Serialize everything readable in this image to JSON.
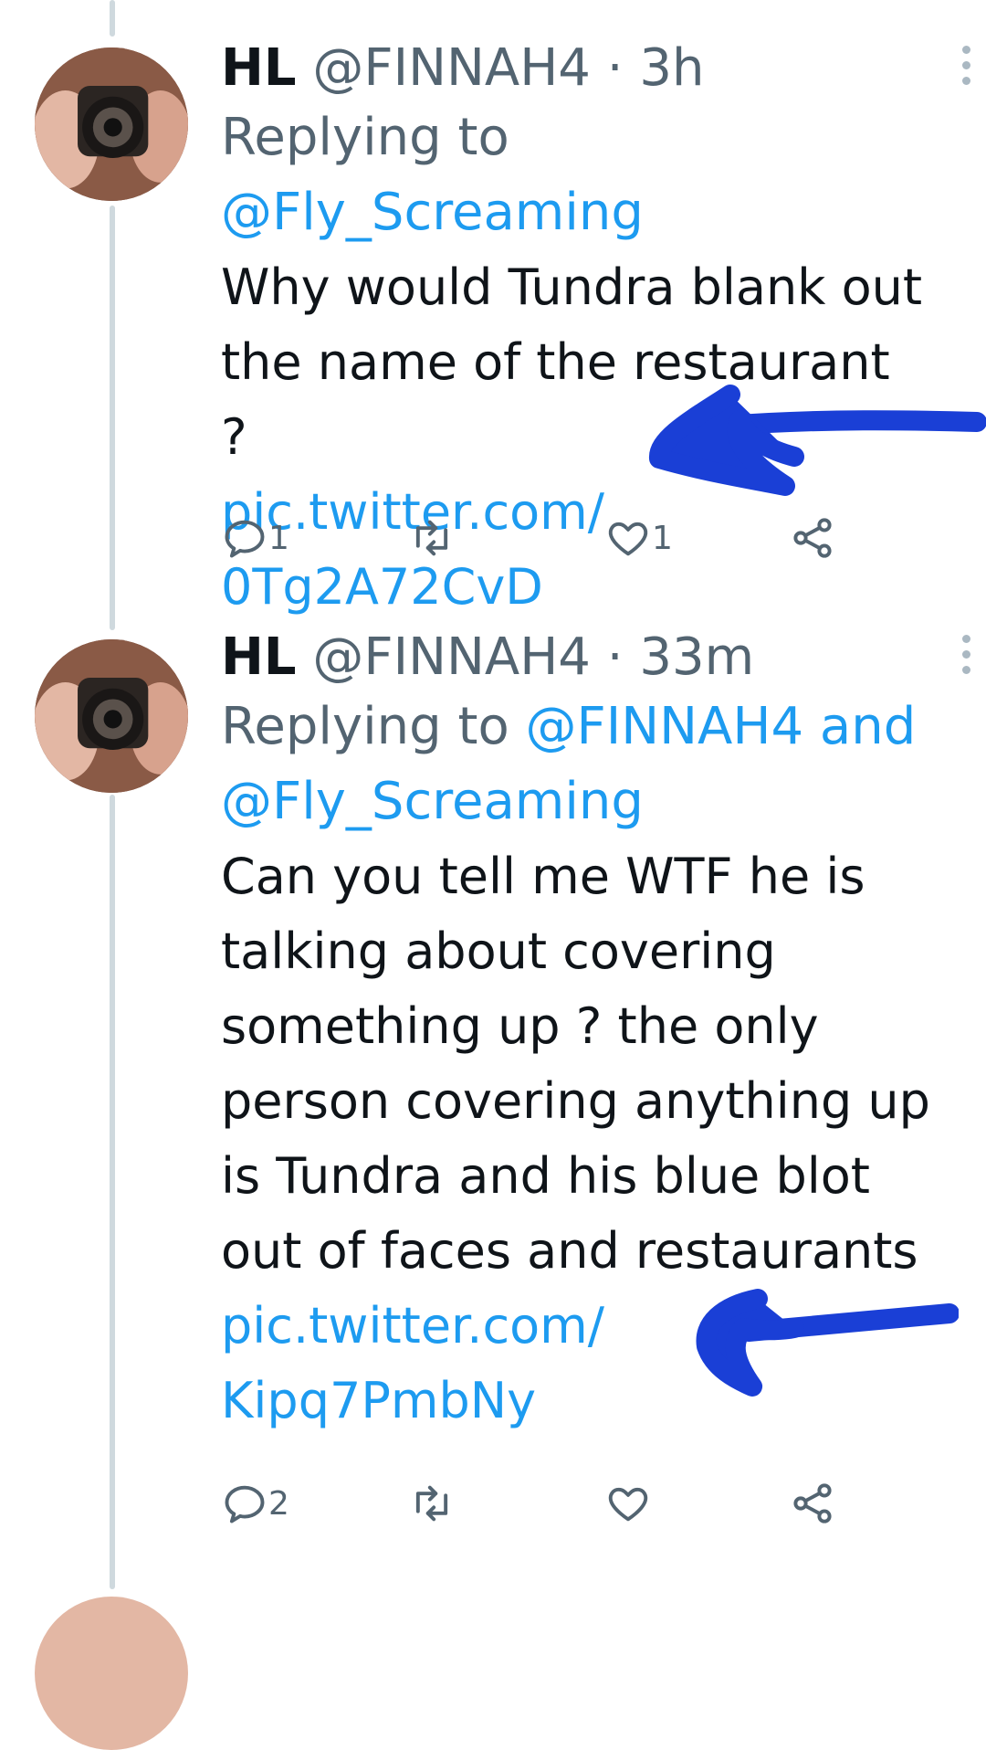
{
  "tweets": [
    {
      "display_name": "HL",
      "handle": "@FINNAH4",
      "separator": "·",
      "time": "3h",
      "reply_prefix": "Replying to",
      "reply_to": "@Fly_Screaming",
      "reply_to_2": "",
      "body_lines": [
        "Why would Tundra blank out",
        "the name of the restaurant ?"
      ],
      "link_lines": [
        "pic.twitter.com/",
        "0Tg2A72CvD"
      ],
      "reply_count": "1",
      "retweet_count": "",
      "like_count": "1"
    },
    {
      "display_name": "HL",
      "handle": "@FINNAH4",
      "separator": "·",
      "time": "33m",
      "reply_prefix": "Replying to",
      "reply_to": "@FINNAH4 and",
      "reply_to_2": "@Fly_Screaming",
      "body_lines": [
        "Can you tell me WTF he is",
        "talking about covering",
        "something up ? the only",
        "person covering anything up",
        "is Tundra and his blue blot",
        "out of faces and restaurants"
      ],
      "link_lines": [
        "pic.twitter.com/",
        "Kipq7PmbNy"
      ],
      "reply_count": "2",
      "retweet_count": "",
      "like_count": ""
    }
  ],
  "colors": {
    "link": "#1d9bf0",
    "secondary_text": "#536471",
    "primary_text": "#0f1419",
    "thread_line": "#cfd9de",
    "annotation_ink": "#1a3fd6"
  },
  "icons": [
    "reply-icon",
    "retweet-icon",
    "like-icon",
    "share-icon",
    "more-icon"
  ]
}
